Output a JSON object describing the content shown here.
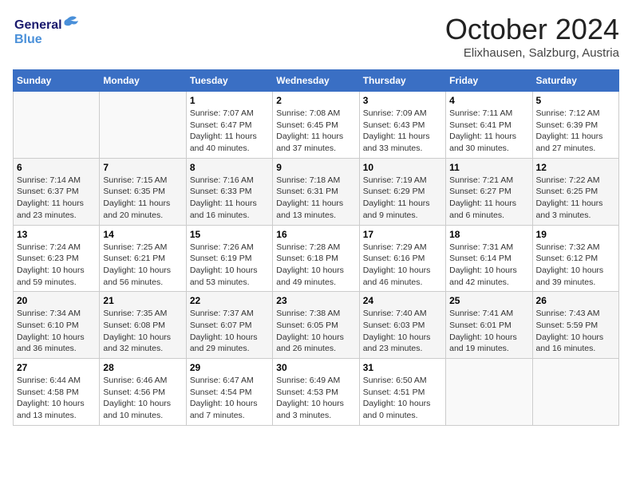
{
  "logo": {
    "line1": "General",
    "line2": "Blue"
  },
  "title": "October 2024",
  "location": "Elixhausen, Salzburg, Austria",
  "days_of_week": [
    "Sunday",
    "Monday",
    "Tuesday",
    "Wednesday",
    "Thursday",
    "Friday",
    "Saturday"
  ],
  "weeks": [
    [
      {
        "day": "",
        "content": ""
      },
      {
        "day": "",
        "content": ""
      },
      {
        "day": "1",
        "content": "Sunrise: 7:07 AM\nSunset: 6:47 PM\nDaylight: 11 hours and 40 minutes."
      },
      {
        "day": "2",
        "content": "Sunrise: 7:08 AM\nSunset: 6:45 PM\nDaylight: 11 hours and 37 minutes."
      },
      {
        "day": "3",
        "content": "Sunrise: 7:09 AM\nSunset: 6:43 PM\nDaylight: 11 hours and 33 minutes."
      },
      {
        "day": "4",
        "content": "Sunrise: 7:11 AM\nSunset: 6:41 PM\nDaylight: 11 hours and 30 minutes."
      },
      {
        "day": "5",
        "content": "Sunrise: 7:12 AM\nSunset: 6:39 PM\nDaylight: 11 hours and 27 minutes."
      }
    ],
    [
      {
        "day": "6",
        "content": "Sunrise: 7:14 AM\nSunset: 6:37 PM\nDaylight: 11 hours and 23 minutes."
      },
      {
        "day": "7",
        "content": "Sunrise: 7:15 AM\nSunset: 6:35 PM\nDaylight: 11 hours and 20 minutes."
      },
      {
        "day": "8",
        "content": "Sunrise: 7:16 AM\nSunset: 6:33 PM\nDaylight: 11 hours and 16 minutes."
      },
      {
        "day": "9",
        "content": "Sunrise: 7:18 AM\nSunset: 6:31 PM\nDaylight: 11 hours and 13 minutes."
      },
      {
        "day": "10",
        "content": "Sunrise: 7:19 AM\nSunset: 6:29 PM\nDaylight: 11 hours and 9 minutes."
      },
      {
        "day": "11",
        "content": "Sunrise: 7:21 AM\nSunset: 6:27 PM\nDaylight: 11 hours and 6 minutes."
      },
      {
        "day": "12",
        "content": "Sunrise: 7:22 AM\nSunset: 6:25 PM\nDaylight: 11 hours and 3 minutes."
      }
    ],
    [
      {
        "day": "13",
        "content": "Sunrise: 7:24 AM\nSunset: 6:23 PM\nDaylight: 10 hours and 59 minutes."
      },
      {
        "day": "14",
        "content": "Sunrise: 7:25 AM\nSunset: 6:21 PM\nDaylight: 10 hours and 56 minutes."
      },
      {
        "day": "15",
        "content": "Sunrise: 7:26 AM\nSunset: 6:19 PM\nDaylight: 10 hours and 53 minutes."
      },
      {
        "day": "16",
        "content": "Sunrise: 7:28 AM\nSunset: 6:18 PM\nDaylight: 10 hours and 49 minutes."
      },
      {
        "day": "17",
        "content": "Sunrise: 7:29 AM\nSunset: 6:16 PM\nDaylight: 10 hours and 46 minutes."
      },
      {
        "day": "18",
        "content": "Sunrise: 7:31 AM\nSunset: 6:14 PM\nDaylight: 10 hours and 42 minutes."
      },
      {
        "day": "19",
        "content": "Sunrise: 7:32 AM\nSunset: 6:12 PM\nDaylight: 10 hours and 39 minutes."
      }
    ],
    [
      {
        "day": "20",
        "content": "Sunrise: 7:34 AM\nSunset: 6:10 PM\nDaylight: 10 hours and 36 minutes."
      },
      {
        "day": "21",
        "content": "Sunrise: 7:35 AM\nSunset: 6:08 PM\nDaylight: 10 hours and 32 minutes."
      },
      {
        "day": "22",
        "content": "Sunrise: 7:37 AM\nSunset: 6:07 PM\nDaylight: 10 hours and 29 minutes."
      },
      {
        "day": "23",
        "content": "Sunrise: 7:38 AM\nSunset: 6:05 PM\nDaylight: 10 hours and 26 minutes."
      },
      {
        "day": "24",
        "content": "Sunrise: 7:40 AM\nSunset: 6:03 PM\nDaylight: 10 hours and 23 minutes."
      },
      {
        "day": "25",
        "content": "Sunrise: 7:41 AM\nSunset: 6:01 PM\nDaylight: 10 hours and 19 minutes."
      },
      {
        "day": "26",
        "content": "Sunrise: 7:43 AM\nSunset: 5:59 PM\nDaylight: 10 hours and 16 minutes."
      }
    ],
    [
      {
        "day": "27",
        "content": "Sunrise: 6:44 AM\nSunset: 4:58 PM\nDaylight: 10 hours and 13 minutes."
      },
      {
        "day": "28",
        "content": "Sunrise: 6:46 AM\nSunset: 4:56 PM\nDaylight: 10 hours and 10 minutes."
      },
      {
        "day": "29",
        "content": "Sunrise: 6:47 AM\nSunset: 4:54 PM\nDaylight: 10 hours and 7 minutes."
      },
      {
        "day": "30",
        "content": "Sunrise: 6:49 AM\nSunset: 4:53 PM\nDaylight: 10 hours and 3 minutes."
      },
      {
        "day": "31",
        "content": "Sunrise: 6:50 AM\nSunset: 4:51 PM\nDaylight: 10 hours and 0 minutes."
      },
      {
        "day": "",
        "content": ""
      },
      {
        "day": "",
        "content": ""
      }
    ]
  ]
}
